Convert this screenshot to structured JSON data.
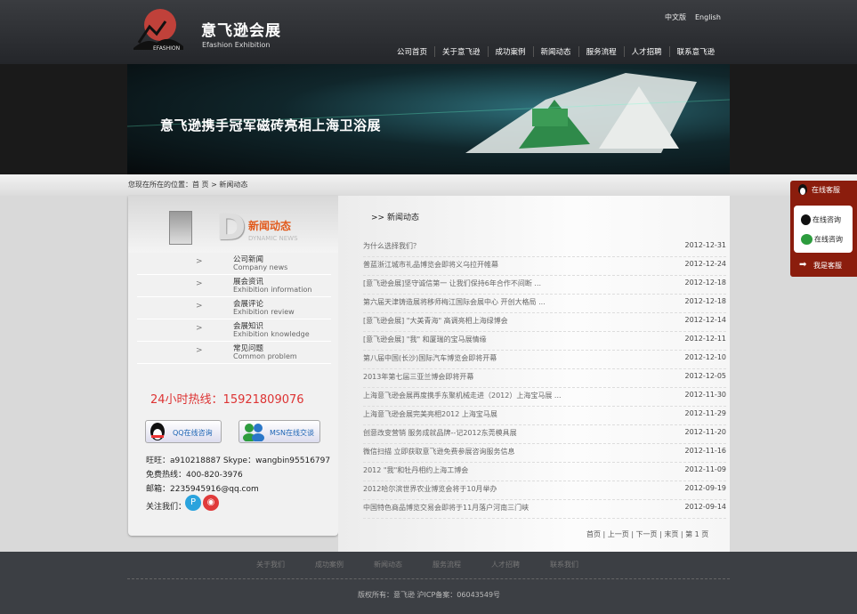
{
  "brand": {
    "cn": "意飞逊会展",
    "en": "Efashion Exhibition",
    "small": "EFASHION"
  },
  "lang": {
    "zh": "中文版",
    "en": "English"
  },
  "nav": [
    "公司首页",
    "关于意飞逊",
    "成功案例",
    "新闻动态",
    "服务流程",
    "人才招聘",
    "联系意飞逊"
  ],
  "banner": {
    "text": "意飞逊携手冠军磁砖亮相上海卫浴展"
  },
  "breadcrumb": "您现在所在的位置：首 页 > 新闻动态",
  "left": {
    "title": "新闻动态",
    "subtitle": "DYNAMIC NEWS",
    "menu": [
      {
        "cn": "公司新闻",
        "en": "Company news"
      },
      {
        "cn": "展会资讯",
        "en": "Exhibition information"
      },
      {
        "cn": "会展评论",
        "en": "Exhibition review"
      },
      {
        "cn": "会展知识",
        "en": "Exhibition knowledge"
      },
      {
        "cn": "常见问题",
        "en": "Common problem"
      }
    ],
    "hotline": "24小时热线：15921809076",
    "qq_label": "QQ在线咨询",
    "msn_label": "MSN在线交谈",
    "contact": [
      "旺旺：a910218887 Skype：wangbin95516797",
      "免费热线：400-820-3976",
      "邮箱：2235945916@qq.com",
      "关注我们："
    ]
  },
  "main": {
    "title": ">> 新闻动态",
    "news": [
      {
        "title": "为什么选择我们？",
        "date": "2012-12-31"
      },
      {
        "title": "普蓝浙江城市礼品博览会即将义乌拉开帷幕",
        "date": "2012-12-24"
      },
      {
        "title": "[意飞逊会展]坚守诚信第一 让我们保持6年合作不间断 ...",
        "date": "2012-12-18"
      },
      {
        "title": "第六届天津铸造展将移师梅江国际会展中心 开创大格局 ...",
        "date": "2012-12-18"
      },
      {
        "title": "[意飞逊会展] \"大美青海\" 高调亮相上海绿博会",
        "date": "2012-12-14"
      },
      {
        "title": "[意飞逊会展] \"我\" 和厦瑞的宝马展情缘",
        "date": "2012-12-11"
      },
      {
        "title": "第八届中国(长沙)国际汽车博览会即将开幕",
        "date": "2012-12-10"
      },
      {
        "title": "2013年第七届三亚兰博会即将开幕",
        "date": "2012-12-05"
      },
      {
        "title": "上海意飞逊会展再度携手东聚机械走进（2012）上海宝马展 ...",
        "date": "2012-11-30"
      },
      {
        "title": "上海意飞逊会展完美亮相2012 上海宝马展",
        "date": "2012-11-29"
      },
      {
        "title": "创意改变营销 服务成就品牌--记2012东莞模具展",
        "date": "2012-11-20"
      },
      {
        "title": "微信扫描 立即获取意飞逊免费参展咨询服务信息",
        "date": "2012-11-16"
      },
      {
        "title": "2012 \"我\"和牡丹相约上海工博会",
        "date": "2012-11-09"
      },
      {
        "title": "2012哈尔滨世界农业博览会将于10月举办",
        "date": "2012-09-19"
      },
      {
        "title": "中国特色商品博览交易会即将于11月落户河南三门峡",
        "date": "2012-09-14"
      }
    ],
    "pager": "首页 | 上一页 | 下一页 | 末页 |  第  1  页"
  },
  "footer": {
    "nav": [
      "关于我们",
      "成功案例",
      "新闻动态",
      "服务流程",
      "人才招聘",
      "联系我们"
    ],
    "copyright": "版权所有：意飞逊 沪ICP备案：06043549号"
  },
  "service": {
    "top": "在线客服",
    "qq1": "在线咨询",
    "qq2": "在线咨询",
    "bottom": "我是客服"
  },
  "colors": {
    "accent": "#e25a1c",
    "header": "#2c2e32",
    "service": "#8b1d0d"
  }
}
